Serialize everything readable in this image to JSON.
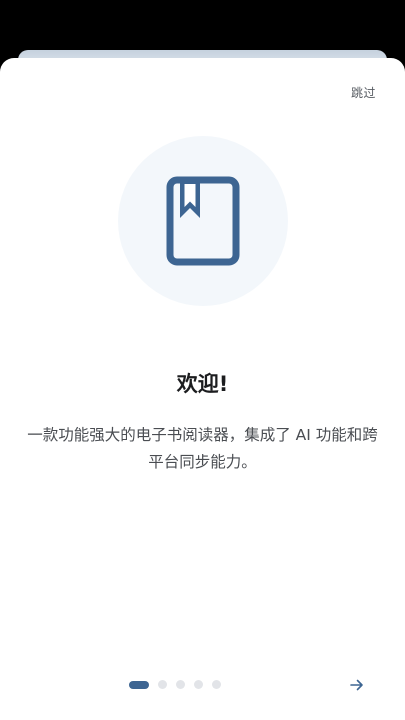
{
  "header": {
    "skip_label": "跳过"
  },
  "hero": {
    "icon": "bookmark-book-icon"
  },
  "content": {
    "title": "欢迎!",
    "description": "一款功能强大的电子书阅读器，集成了 AI 功能和跨平台同步能力。"
  },
  "pager": {
    "total_pages": 5,
    "current_page": 1
  },
  "footer": {
    "next_icon": "arrow-right-icon"
  },
  "colors": {
    "accent": "#3d6592",
    "hero_background": "#f3f7fb",
    "inactive_dot": "#e2e4e8",
    "title_text": "#1c1d1f",
    "body_text": "#4a4d52"
  }
}
